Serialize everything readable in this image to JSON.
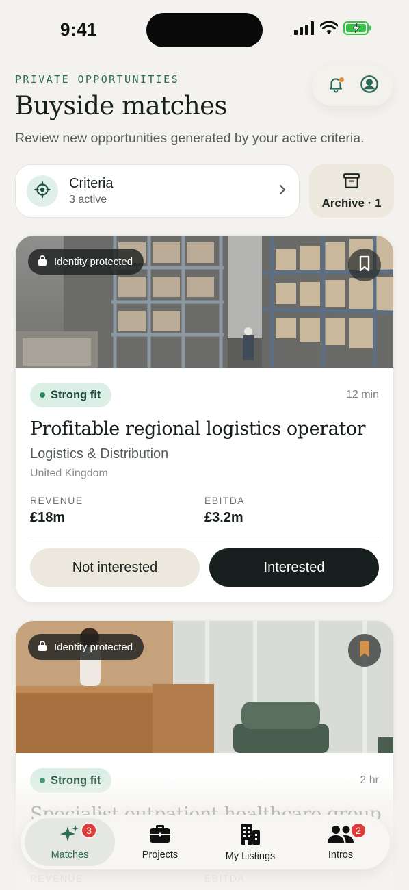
{
  "status_bar": {
    "time": "9:41"
  },
  "header": {
    "eyebrow": "PRIVATE OPPORTUNITIES",
    "title": "Buyside matches",
    "subtitle": "Review new opportunities generated by your active criteria.",
    "icons": [
      "bell-icon",
      "account-icon"
    ],
    "notification_dot_color": "#e38b3c"
  },
  "criteria": {
    "title": "Criteria",
    "subtitle": "3 active"
  },
  "archive": {
    "label": "Archive · 1"
  },
  "cards": [
    {
      "badge": "Identity protected",
      "fit": "Strong fit",
      "age": "12 min",
      "title": "Profitable regional logistics operator",
      "sector": "Logistics & Distribution",
      "country": "United Kingdom",
      "metrics": [
        {
          "label": "REVENUE",
          "value": "£18m"
        },
        {
          "label": "EBITDA",
          "value": "£3.2m"
        }
      ],
      "secondary_action": "Not interested",
      "primary_action": "Interested",
      "bookmarked": false
    },
    {
      "badge": "Identity protected",
      "fit": "Strong fit",
      "age": "2 hr",
      "title": "Specialist outpatient healthcare group",
      "metrics": [
        {
          "label": "REVENUE"
        },
        {
          "label": "EBITDA"
        }
      ],
      "bookmarked": true
    }
  ],
  "tabs": [
    {
      "label": "Matches",
      "badge": "3",
      "active": true
    },
    {
      "label": "Projects"
    },
    {
      "label": "My Listings"
    },
    {
      "label": "Intros",
      "badge": "2"
    }
  ],
  "colors": {
    "accent": "#2a6b58",
    "fit_badge_bg": "#dcefe6",
    "primary_button": "#17201e",
    "secondary_button": "#ece8dd",
    "tab_badge": "#e03b3b",
    "bookmark_active": "#d4924a"
  }
}
